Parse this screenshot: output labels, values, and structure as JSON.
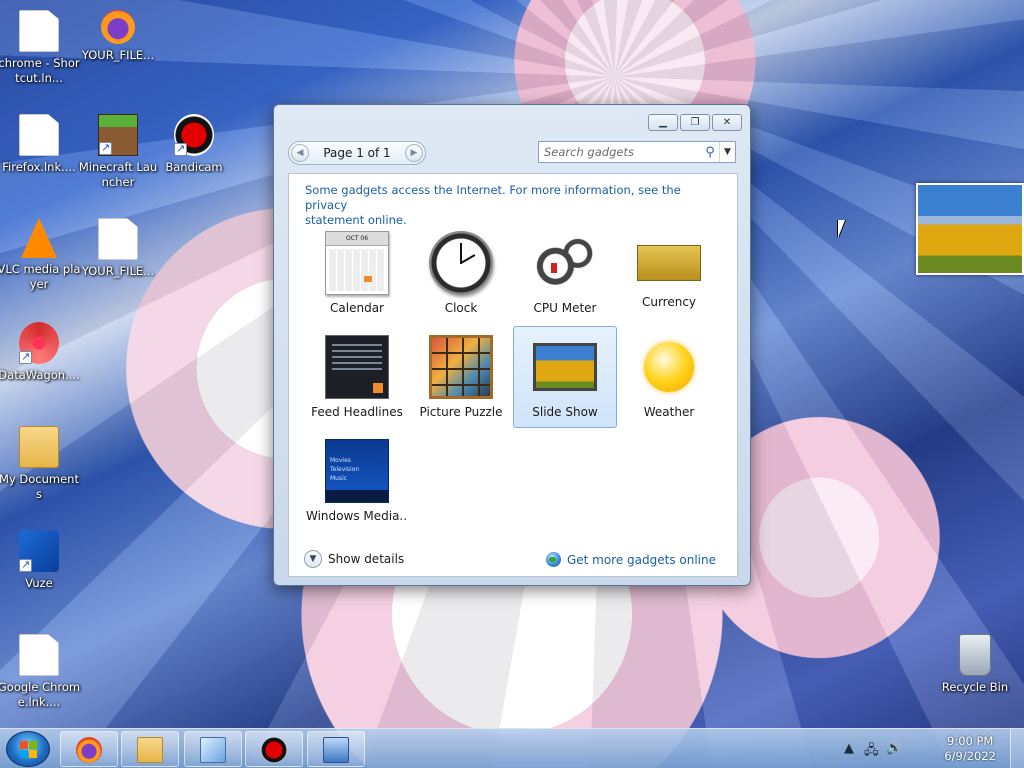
{
  "desktop": {
    "icons": [
      {
        "label": "chrome - Shortcut.ln...",
        "icon": "document-icon"
      },
      {
        "label": "YOUR_FILE...",
        "icon": "firefox-icon"
      },
      {
        "label": "Firefox.lnk....",
        "icon": "document-icon"
      },
      {
        "label": "Minecraft Launcher",
        "icon": "minecraft-icon"
      },
      {
        "label": "Bandicam",
        "icon": "bandicam-icon"
      },
      {
        "label": "VLC media player",
        "icon": "vlc-icon"
      },
      {
        "label": "YOUR_FILE...",
        "icon": "document-icon"
      },
      {
        "label": "DataWagon....",
        "icon": "datawagon-icon"
      },
      {
        "label": "My Documents",
        "icon": "folder-icon"
      },
      {
        "label": "Vuze",
        "icon": "vuze-icon"
      },
      {
        "label": "Google Chrome.lnk....",
        "icon": "document-icon"
      },
      {
        "label": "Recycle Bin",
        "icon": "recycle-bin-icon"
      }
    ]
  },
  "gadget_window": {
    "pager_text": "Page 1 of 1",
    "search_placeholder": "Search gadgets",
    "notice_line1": "Some gadgets access the Internet.  For more information, see the privacy",
    "notice_line2": "statement online.",
    "calendar_month": "OCT 06",
    "gadgets": [
      {
        "label": "Calendar",
        "icon": "calendar-icon"
      },
      {
        "label": "Clock",
        "icon": "clock-icon"
      },
      {
        "label": "CPU Meter",
        "icon": "cpu-meter-icon"
      },
      {
        "label": "Currency",
        "icon": "currency-icon"
      },
      {
        "label": "Feed Headlines",
        "icon": "feed-headlines-icon"
      },
      {
        "label": "Picture Puzzle",
        "icon": "picture-puzzle-icon"
      },
      {
        "label": "Slide Show",
        "icon": "slide-show-icon",
        "selected": true
      },
      {
        "label": "Weather",
        "icon": "weather-icon"
      },
      {
        "label": "Windows Media...",
        "icon": "windows-media-center-icon"
      }
    ],
    "wmc_menu": [
      "Movies",
      "Television",
      "Music"
    ],
    "show_details": "Show details",
    "get_more": "Get more gadgets online"
  },
  "taskbar": {
    "items": [
      "firefox-icon",
      "explorer-folder-icon",
      "control-panel-icon",
      "bandicam-record-icon",
      "remote-desktop-icon"
    ],
    "tray": {
      "time": "9:00 PM",
      "date": "6/9/2022"
    }
  },
  "colors": {
    "link": "#1a5fa8",
    "selection": "#cfe4fa",
    "accent": "#3462a8"
  }
}
